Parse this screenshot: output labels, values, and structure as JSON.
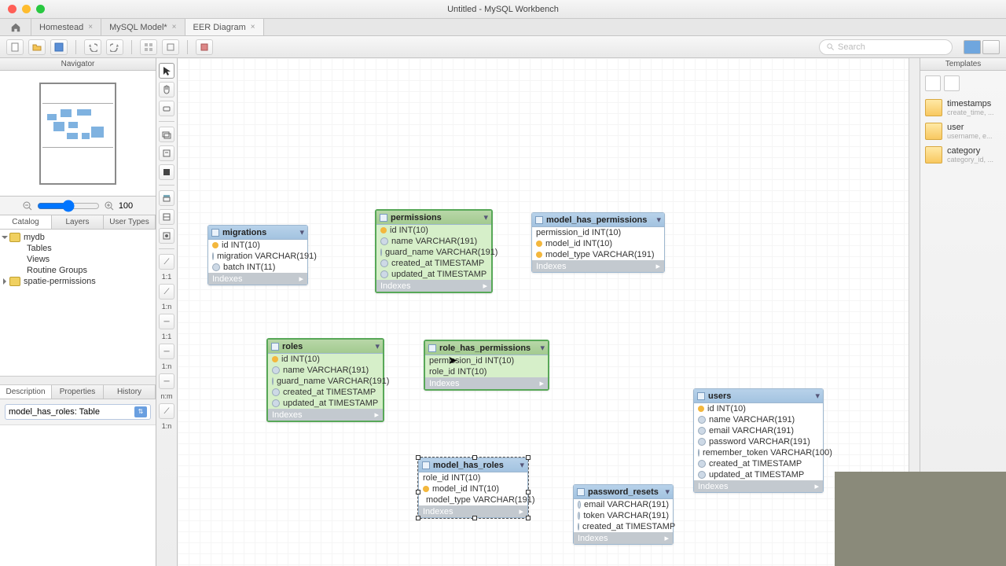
{
  "window": {
    "title": "Untitled - MySQL Workbench"
  },
  "tabs": [
    "Homestead",
    "MySQL Model*",
    "EER Diagram"
  ],
  "activeTab": 2,
  "search": {
    "placeholder": "Search"
  },
  "navigator": {
    "label": "Navigator"
  },
  "zoom": {
    "value": "100"
  },
  "catalogTabs": [
    "Catalog",
    "Layers",
    "User Types"
  ],
  "tree": {
    "mydb": {
      "name": "mydb",
      "children": [
        "Tables",
        "Views",
        "Routine Groups"
      ]
    },
    "schema2": "spatie-permissions"
  },
  "descTabs": [
    "Description",
    "Properties",
    "History"
  ],
  "combo": "model_has_roles: Table",
  "templatesLabel": "Templates",
  "templates": [
    {
      "name": "timestamps",
      "sub": "create_time, ..."
    },
    {
      "name": "user",
      "sub": "username, e..."
    },
    {
      "name": "category",
      "sub": "category_id, ..."
    }
  ],
  "indexesLabel": "Indexes",
  "tables": {
    "migrations": {
      "title": "migrations",
      "cols": [
        "id INT(10)",
        "migration VARCHAR(191)",
        "batch INT(11)"
      ]
    },
    "permissions": {
      "title": "permissions",
      "cols": [
        "id INT(10)",
        "name VARCHAR(191)",
        "guard_name VARCHAR(191)",
        "created_at TIMESTAMP",
        "updated_at TIMESTAMP"
      ]
    },
    "model_has_permissions": {
      "title": "model_has_permissions",
      "cols": [
        "permission_id INT(10)",
        "model_id INT(10)",
        "model_type VARCHAR(191)"
      ]
    },
    "roles": {
      "title": "roles",
      "cols": [
        "id INT(10)",
        "name VARCHAR(191)",
        "guard_name VARCHAR(191)",
        "created_at TIMESTAMP",
        "updated_at TIMESTAMP"
      ]
    },
    "role_has_permissions": {
      "title": "role_has_permissions",
      "cols": [
        "permission_id INT(10)",
        "role_id INT(10)"
      ]
    },
    "model_has_roles": {
      "title": "model_has_roles",
      "cols": [
        "role_id INT(10)",
        "model_id INT(10)",
        "model_type VARCHAR(191)"
      ]
    },
    "password_resets": {
      "title": "password_resets",
      "cols": [
        "email VARCHAR(191)",
        "token VARCHAR(191)",
        "created_at TIMESTAMP"
      ]
    },
    "users": {
      "title": "users",
      "cols": [
        "id INT(10)",
        "name VARCHAR(191)",
        "email VARCHAR(191)",
        "password VARCHAR(191)",
        "remember_token VARCHAR(100)",
        "created_at TIMESTAMP",
        "updated_at TIMESTAMP"
      ]
    }
  }
}
